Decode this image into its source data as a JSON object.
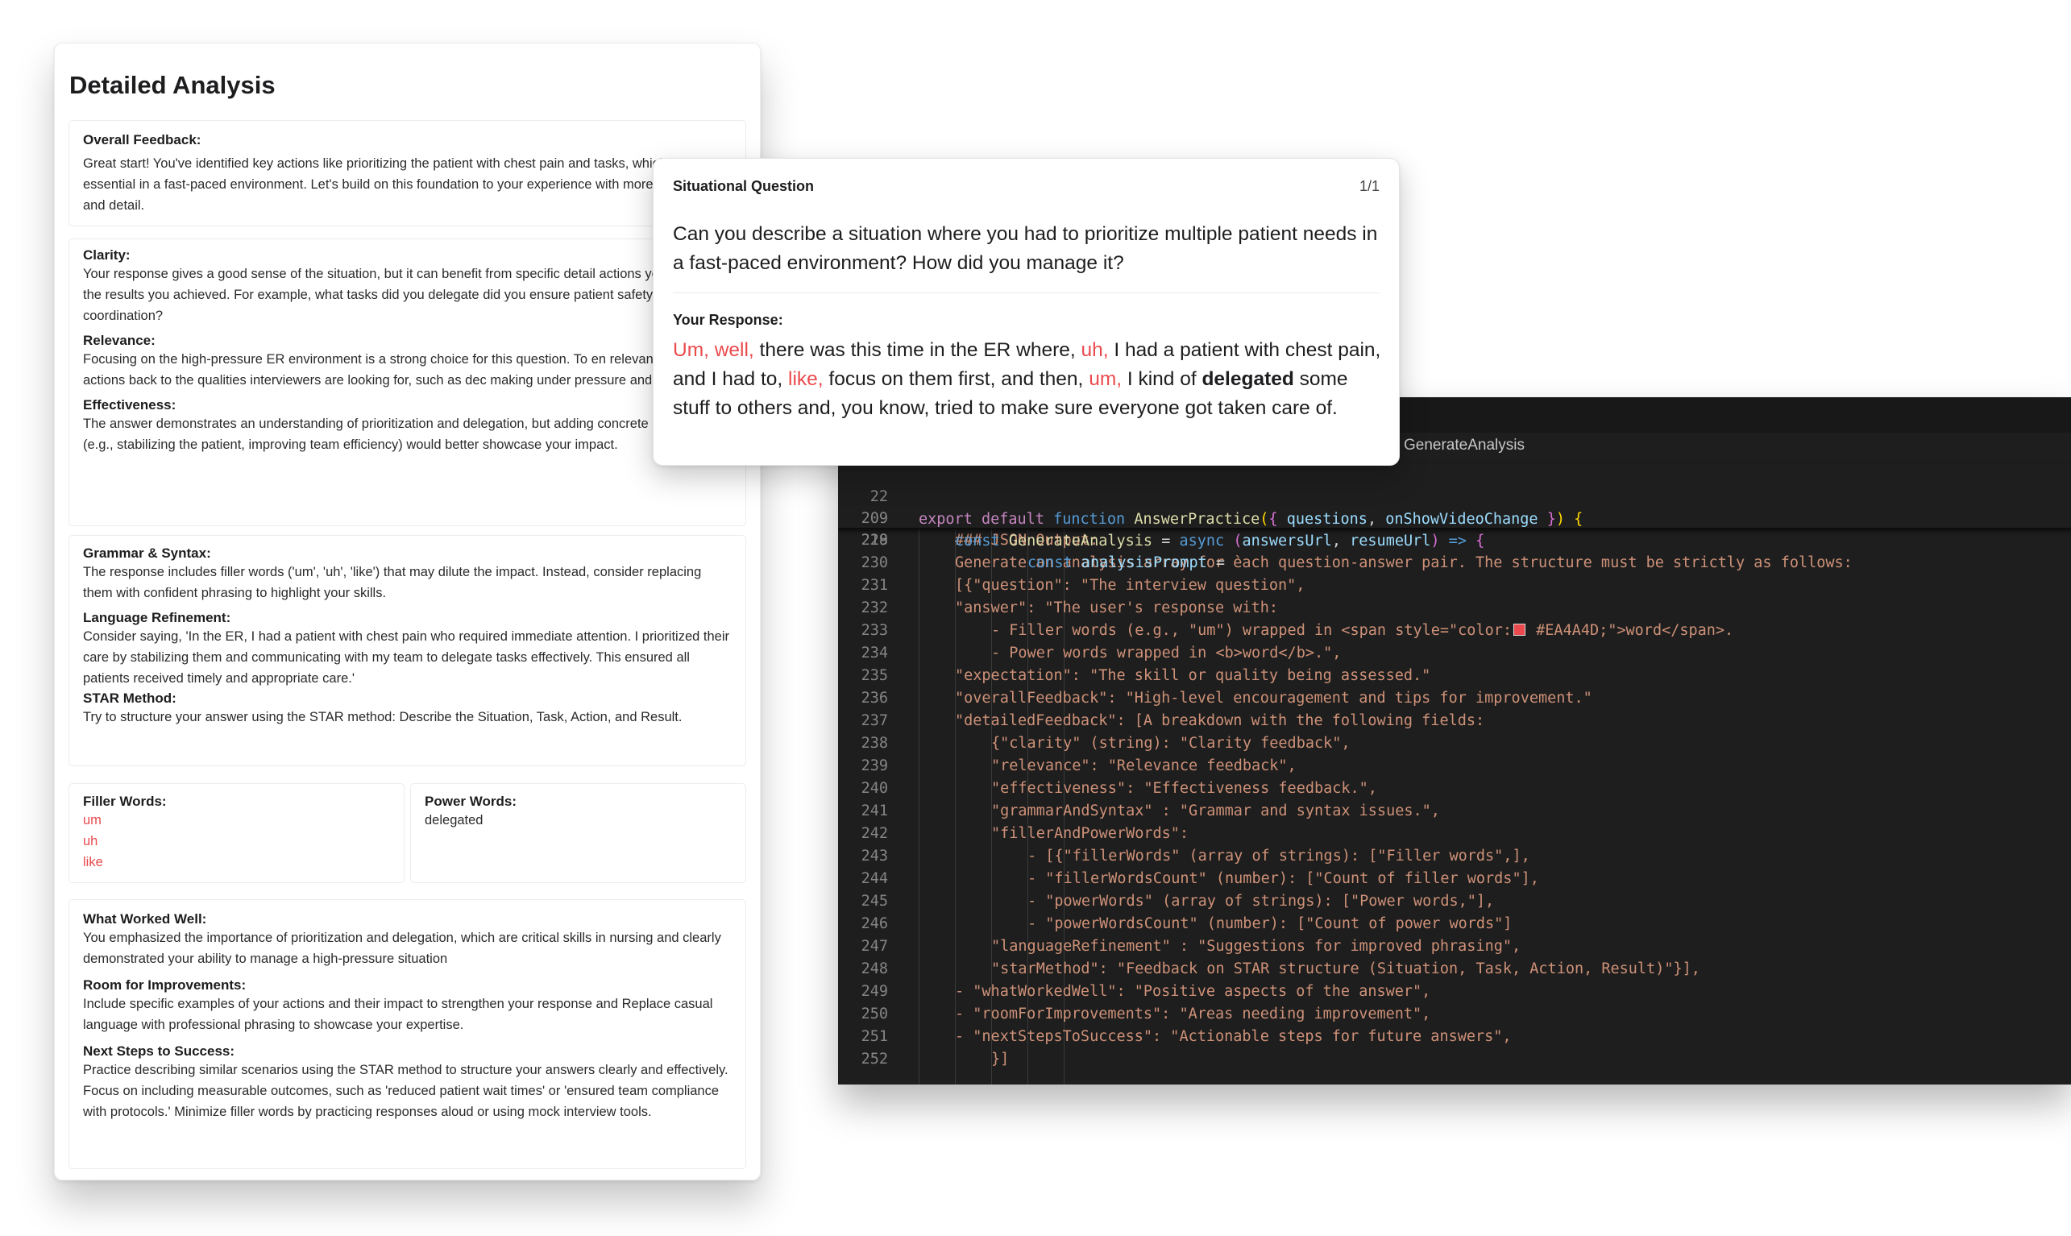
{
  "analysis": {
    "title": "Detailed Analysis",
    "overall_feedback": {
      "heading": "Overall Feedback:",
      "body": "Great start! You've identified key actions like prioritizing the patient with chest pain and tasks, which are essential in a fast-paced environment. Let's build on this foundation to your experience with more confidence and detail."
    },
    "clarity": {
      "heading": "Clarity:",
      "body": "Your response gives a good sense of the situation, but it can benefit from specific detail actions you took and the results you achieved. For example, what tasks did you delegate did you ensure patient safety and team coordination?"
    },
    "relevance": {
      "heading": "Relevance:",
      "body": "Focusing on the high-pressure ER environment is a strong choice for this question. To en relevance, tie your actions back to the qualities interviewers are looking for, such as dec making under pressure and teamwork."
    },
    "effectiveness": {
      "heading": "Effectiveness:",
      "body": "The answer demonstrates an understanding of prioritization and delegation, but adding concrete outcomes (e.g., stabilizing the patient, improving team efficiency) would better showcase your impact."
    },
    "grammar": {
      "heading": "Grammar & Syntax:",
      "body": "The response includes filler words ('um', 'uh', 'like') that may dilute the impact. Instead, consider replacing them with confident phrasing to highlight your skills."
    },
    "language": {
      "heading": "Language Refinement:",
      "body": "Consider saying, 'In the ER, I had a patient with chest pain who required immediate attention. I prioritized their care by stabilizing them and communicating with my team to delegate tasks effectively. This ensured all patients received timely and appropriate care.'"
    },
    "star": {
      "heading": "STAR Method:",
      "body": "Try to structure your answer using the STAR method: Describe the Situation, Task, Action, and Result."
    },
    "filler_words": {
      "heading": "Filler Words:",
      "items": [
        "um",
        "uh",
        "like"
      ]
    },
    "power_words": {
      "heading": "Power Words:",
      "items": [
        "delegated"
      ]
    },
    "worked_well": {
      "heading": "What Worked Well:",
      "body": "You emphasized the importance of prioritization and delegation, which are critical skills in nursing and clearly demonstrated your ability to manage a high-pressure situation"
    },
    "improvements": {
      "heading": "Room for Improvements:",
      "body": "Include specific examples of your actions and their impact to strengthen your response and Replace casual language with professional phrasing to showcase your expertise."
    },
    "next_steps": {
      "heading": "Next Steps to Success:",
      "body": "Practice describing similar scenarios using the STAR method to structure your answers clearly and effectively. Focus on including measurable outcomes, such as 'reduced patient wait times' or 'ensured team compliance with protocols.' Minimize filler words by practicing responses aloud or using mock interview tools."
    }
  },
  "question_card": {
    "label": "Situational Question",
    "counter": "1/1",
    "question": "Can you describe a situation where you had to prioritize multiple patient needs in a fast-paced environment? How did you manage it?",
    "response_label": "Your Response:",
    "response": {
      "p1": "Um, well,",
      "p2": " there was this time in the ER where, ",
      "p3": "uh,",
      "p4": " I had a patient with chest pain, and I had to, ",
      "p5": "like,",
      "p6": " focus on them first, and then, ",
      "p7": "um,",
      "p8": " I kind of ",
      "p9": "delegated",
      "p10": " some stuff to others and, you know, tried to make sure everyone got taken care of."
    }
  },
  "code_editor": {
    "breadcrumb": "GenerateAnalysis",
    "sticky_lines": [
      {
        "num": "22",
        "kind": "s1"
      },
      {
        "num": "209",
        "kind": "s2"
      },
      {
        "num": "218",
        "kind": "s3"
      }
    ],
    "sticky_text": {
      "export": "export",
      "default": "default",
      "function": "function",
      "fn_name": "AnswerPractice",
      "params": "questions",
      "params2": "onShowVideoChange",
      "const": "const",
      "gen": "GenerateAnalysis",
      "async": "async",
      "a1": "answersUrl",
      "a2": "resumeUrl",
      "prompt": "analysisPrompt"
    },
    "lines": [
      {
        "num": "229",
        "indent": 3,
        "text": "### JSON Output:"
      },
      {
        "num": "230",
        "indent": 3,
        "text": "Generate an analysis array for each question-answer pair. The structure must be strictly as follows:"
      },
      {
        "num": "231",
        "indent": 3,
        "text": "[{\"question\": \"The interview question\","
      },
      {
        "num": "232",
        "indent": 3,
        "text": "\"answer\": \"The user's response with:"
      },
      {
        "num": "233",
        "indent": 4,
        "text": "- Filler words (e.g., \"um\") wrapped in <span style=\"color:",
        "swatch": true,
        "text2": " #EA4A4D;\">word</span>."
      },
      {
        "num": "234",
        "indent": 4,
        "text": "- Power words wrapped in <b>word</b>.\","
      },
      {
        "num": "235",
        "indent": 3,
        "text": "\"expectation\": \"The skill or quality being assessed.\""
      },
      {
        "num": "236",
        "indent": 3,
        "text": "\"overallFeedback\": \"High-level encouragement and tips for improvement.\""
      },
      {
        "num": "237",
        "indent": 3,
        "text": "\"detailedFeedback\": [A breakdown with the following fields:"
      },
      {
        "num": "238",
        "indent": 4,
        "text": "{\"clarity\" (string): \"Clarity feedback\","
      },
      {
        "num": "239",
        "indent": 4,
        "text": "\"relevance\": \"Relevance feedback\","
      },
      {
        "num": "240",
        "indent": 4,
        "text": "\"effectiveness\": \"Effectiveness feedback.\","
      },
      {
        "num": "241",
        "indent": 4,
        "text": "\"grammarAndSyntax\" : \"Grammar and syntax issues.\","
      },
      {
        "num": "242",
        "indent": 4,
        "text": "\"fillerAndPowerWords\":"
      },
      {
        "num": "243",
        "indent": 5,
        "text": "- [{\"fillerWords\" (array of strings): [\"Filler words\",],"
      },
      {
        "num": "244",
        "indent": 5,
        "text": "- \"fillerWordsCount\" (number): [\"Count of filler words\"],"
      },
      {
        "num": "245",
        "indent": 5,
        "text": "- \"powerWords\" (array of strings): [\"Power words,\"],"
      },
      {
        "num": "246",
        "indent": 5,
        "text": "- \"powerWordsCount\" (number): [\"Count of power words\"]"
      },
      {
        "num": "247",
        "indent": 4,
        "text": "\"languageRefinement\" : \"Suggestions for improved phrasing\","
      },
      {
        "num": "248",
        "indent": 4,
        "text": "\"starMethod\": \"Feedback on STAR structure (Situation, Task, Action, Result)\"}],"
      },
      {
        "num": "249",
        "indent": 3,
        "text": "- \"whatWorkedWell\": \"Positive aspects of the answer\","
      },
      {
        "num": "250",
        "indent": 3,
        "text": "- \"roomForImprovements\": \"Areas needing improvement\","
      },
      {
        "num": "251",
        "indent": 3,
        "text": "- \"nextStepsToSuccess\": \"Actionable steps for future answers\","
      },
      {
        "num": "252",
        "indent": 4,
        "text": "}]"
      }
    ]
  },
  "colors": {
    "filler": "#EA4A4D",
    "editor_bg": "#1e1e1e",
    "code_string": "#ce9178"
  }
}
